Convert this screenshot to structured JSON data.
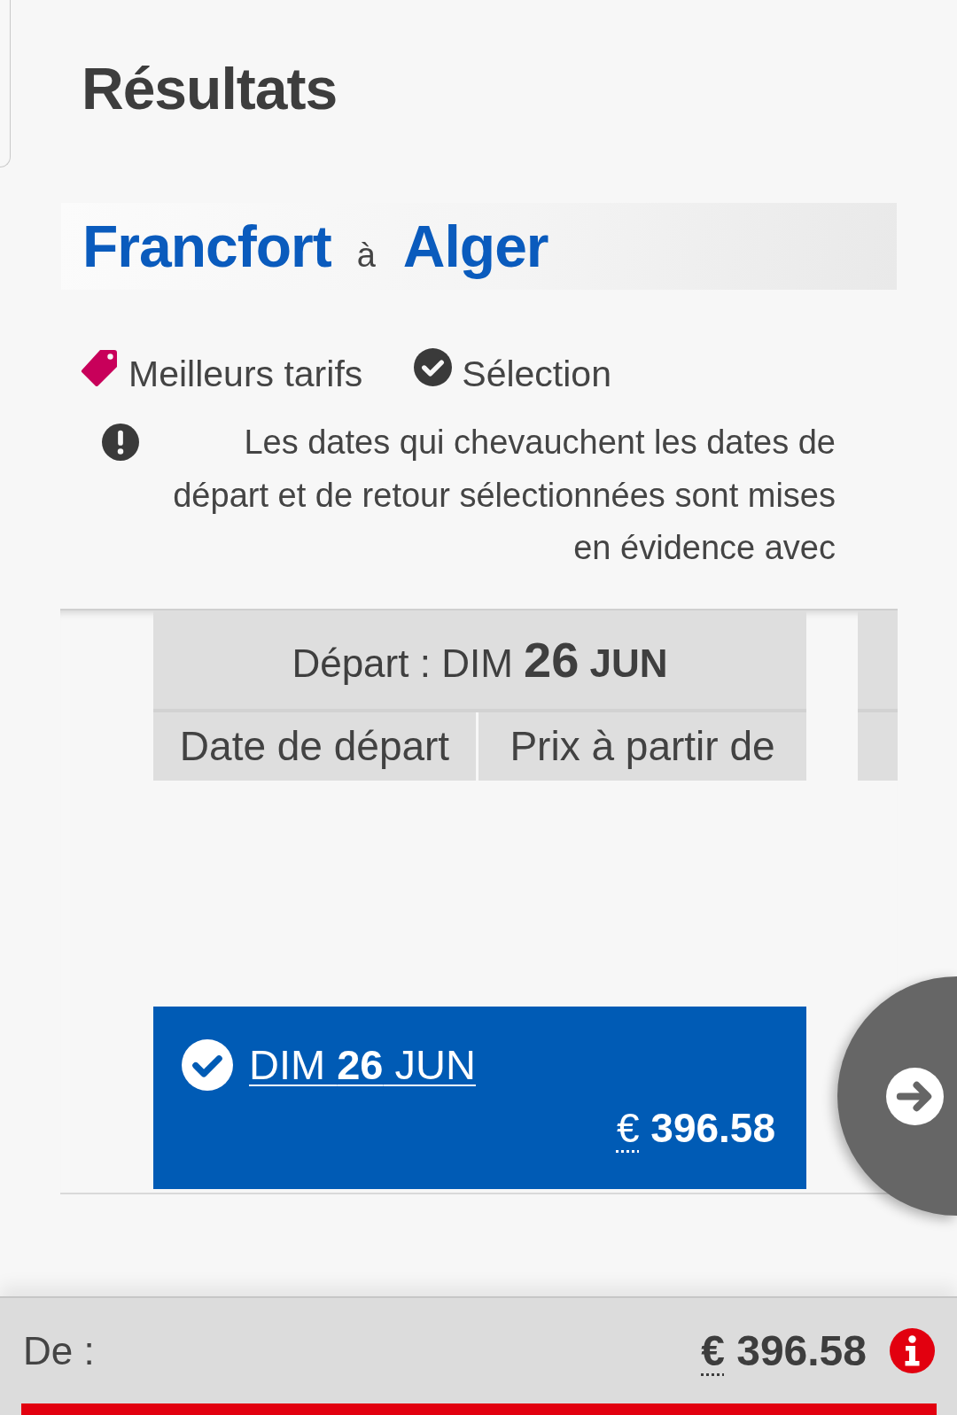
{
  "page_title": "Résultats",
  "route": {
    "origin": "Francfort",
    "connector": "à",
    "destination": "Alger"
  },
  "legend": [
    {
      "kind": "best_fare",
      "label": "Meilleurs tarifs"
    },
    {
      "kind": "selection",
      "label": "Sélection"
    }
  ],
  "notice": "Les dates qui chevauchent les dates de départ et de retour sélectionnées sont mises en évidence avec",
  "date_columns": [
    {
      "title": "Départ : DIM **26** **JUN**",
      "columns": [
        "Date de départ",
        "Prix à partir de"
      ],
      "cells": [
        {
          "date": "DIM **26** JUN",
          "price": {
            "currency": "€",
            "amount": "396.58"
          },
          "selected": true
        }
      ]
    },
    {}
  ],
  "summary": {
    "label": "De :",
    "price": {
      "currency": "€",
      "amount": "396.58"
    }
  }
}
